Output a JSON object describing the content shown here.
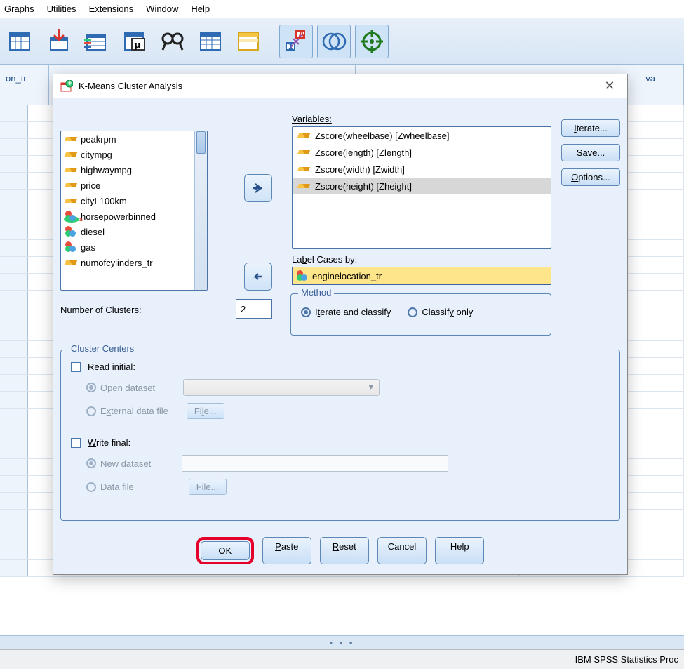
{
  "menu": {
    "graphs": "Graphs",
    "utilities": "Utilities",
    "extensions": "Extensions",
    "window": "Window",
    "help": "Help"
  },
  "grid": {
    "firstCol": "on_tr",
    "lastCol": "va"
  },
  "status": "IBM SPSS Statistics Proc",
  "dialog": {
    "title": "K-Means Cluster Analysis",
    "sourceVars": [
      "peakrpm",
      "citympg",
      "highwaympg",
      "price",
      "cityL100km",
      "horsepowerbinned",
      "diesel",
      "gas",
      "numofcylinders_tr"
    ],
    "sourceIcons": [
      "ruler",
      "ruler",
      "ruler",
      "ruler",
      "ruler",
      "ballsA",
      "balls",
      "balls",
      "ruler"
    ],
    "varsLabel": "Variables:",
    "variables": [
      "Zscore(wheelbase) [Zwheelbase]",
      "Zscore(length) [Zlength]",
      "Zscore(width) [Zwidth]",
      "Zscore(height) [Zheight]"
    ],
    "selectedVarIndex": 3,
    "side": {
      "iterate": "Iterate...",
      "save": "Save...",
      "options": "Options..."
    },
    "labelCases": {
      "label": "Label Cases by:",
      "value": "enginelocation_tr"
    },
    "numClusters": {
      "label": "Number of Clusters:",
      "value": "2"
    },
    "method": {
      "legend": "Method",
      "opt1": "Iterate and classify",
      "opt2": "Classify only"
    },
    "cc": {
      "legend": "Cluster Centers",
      "readInitial": "Read initial:",
      "openDataset": "Open dataset",
      "externalFile": "External data file",
      "fileBtn": "File...",
      "writeFinal": "Write final:",
      "newDataset": "New dataset",
      "dataFile": "Data file"
    },
    "buttons": {
      "ok": "OK",
      "paste": "Paste",
      "reset": "Reset",
      "cancel": "Cancel",
      "help": "Help"
    }
  }
}
